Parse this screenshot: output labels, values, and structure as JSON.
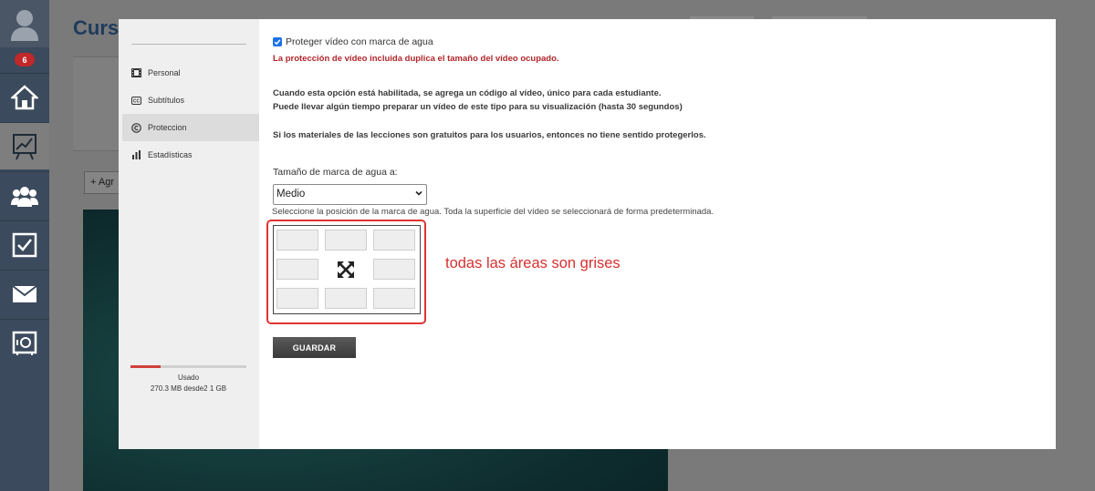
{
  "rail": {
    "badge_count": "6",
    "items": [
      {
        "icon": "home-icon"
      },
      {
        "icon": "chart-icon"
      },
      {
        "icon": "users-icon"
      },
      {
        "icon": "checkbox-icon"
      },
      {
        "icon": "mail-icon"
      },
      {
        "icon": "safe-icon"
      }
    ]
  },
  "background": {
    "title": "Curs",
    "add_button": "+ Agr"
  },
  "modal": {
    "nav": [
      {
        "label": "Personal",
        "icon": "film-icon"
      },
      {
        "label": "Subtítulos",
        "icon": "cc-icon"
      },
      {
        "label": "Proteccion",
        "icon": "copyright-icon"
      },
      {
        "label": "Estadísticas",
        "icon": "bar-chart-icon"
      }
    ],
    "active_nav": "Proteccion",
    "usage": {
      "label": "Usado",
      "value": "270.3 MB desde2 1 GB",
      "fraction": 0.26
    },
    "protect_checkbox_label": "Proteger vídeo con marca de agua",
    "protect_checked": true,
    "warning": "La protección de vídeo incluida duplica el tamaño del vídeo ocupado.",
    "info_line1": "Cuando esta opción está habilitada, se agrega un código al vídeo, único para cada estudiante.",
    "info_line2": "Puede llevar algún tiempo preparar un vídeo de este tipo para su visualización (hasta 30 segundos)",
    "info_line3": "Si los materiales de las lecciones son gratuitos para los usuarios, entonces no tiene sentido protegerlos.",
    "size_label": "Tamaño de marca de agua a:",
    "size_value": "Medio",
    "position_help": "Seleccione la posición de la marca de agua. Toda la superficie del vídeo se seleccionará de forma predeterminada.",
    "annotation": "todas las áreas son grises",
    "save_label": "GUARDAR"
  },
  "colors": {
    "warning": "#b1262a",
    "annotation": "#d6302f",
    "rail": "#3b4a5c"
  }
}
